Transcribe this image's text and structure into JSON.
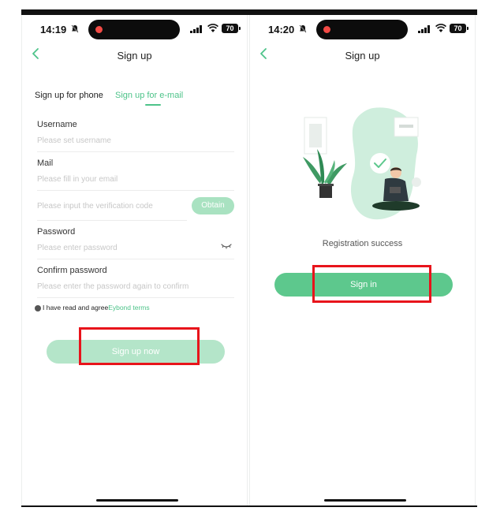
{
  "colors": {
    "accent": "#4dc389",
    "button_disabled": "#b4e5c9",
    "button_active": "#5dc88d",
    "highlight": "#e8141b"
  },
  "left_screen": {
    "status": {
      "time": "14:19",
      "battery": "70"
    },
    "nav": {
      "title": "Sign up"
    },
    "tabs": {
      "phone": "Sign up for phone",
      "email": "Sign up for e-mail"
    },
    "fields": {
      "username": {
        "label": "Username",
        "placeholder": "Please set username"
      },
      "mail": {
        "label": "Mail",
        "placeholder": "Please fill in your email"
      },
      "verification": {
        "placeholder": "Please input the verification code",
        "button": "Obtain"
      },
      "password": {
        "label": "Password",
        "placeholder": "Please enter password"
      },
      "confirm": {
        "label": "Confirm password",
        "placeholder": "Please enter the password again to confirm"
      }
    },
    "agreement": {
      "text": "I have read and agree",
      "link": "Eybond terms"
    },
    "submit_label": "Sign up now"
  },
  "right_screen": {
    "status": {
      "time": "14:20",
      "battery": "70"
    },
    "nav": {
      "title": "Sign up"
    },
    "success_text": "Registration success",
    "signin_label": "Sign in"
  }
}
